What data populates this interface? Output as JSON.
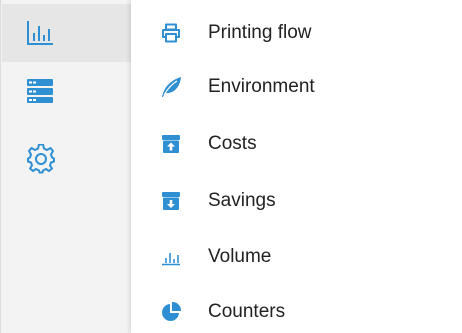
{
  "colors": {
    "accent": "#2f8fd3",
    "rail_background": "#f3f3f3",
    "rail_active": "#e6e6e6",
    "text": "#222222"
  },
  "rail": {
    "items": [
      {
        "icon": "bar-chart-icon",
        "active": true
      },
      {
        "icon": "server-list-icon",
        "active": false
      },
      {
        "icon": "gear-icon",
        "active": false
      }
    ]
  },
  "menu": {
    "items": [
      {
        "label": "Printing flow",
        "icon": "printer-icon"
      },
      {
        "label": "Environment",
        "icon": "leaf-icon"
      },
      {
        "label": "Costs",
        "icon": "box-upload-icon"
      },
      {
        "label": "Savings",
        "icon": "box-download-icon"
      },
      {
        "label": "Volume",
        "icon": "bar-chart-icon"
      },
      {
        "label": "Counters",
        "icon": "pie-chart-icon"
      }
    ]
  }
}
